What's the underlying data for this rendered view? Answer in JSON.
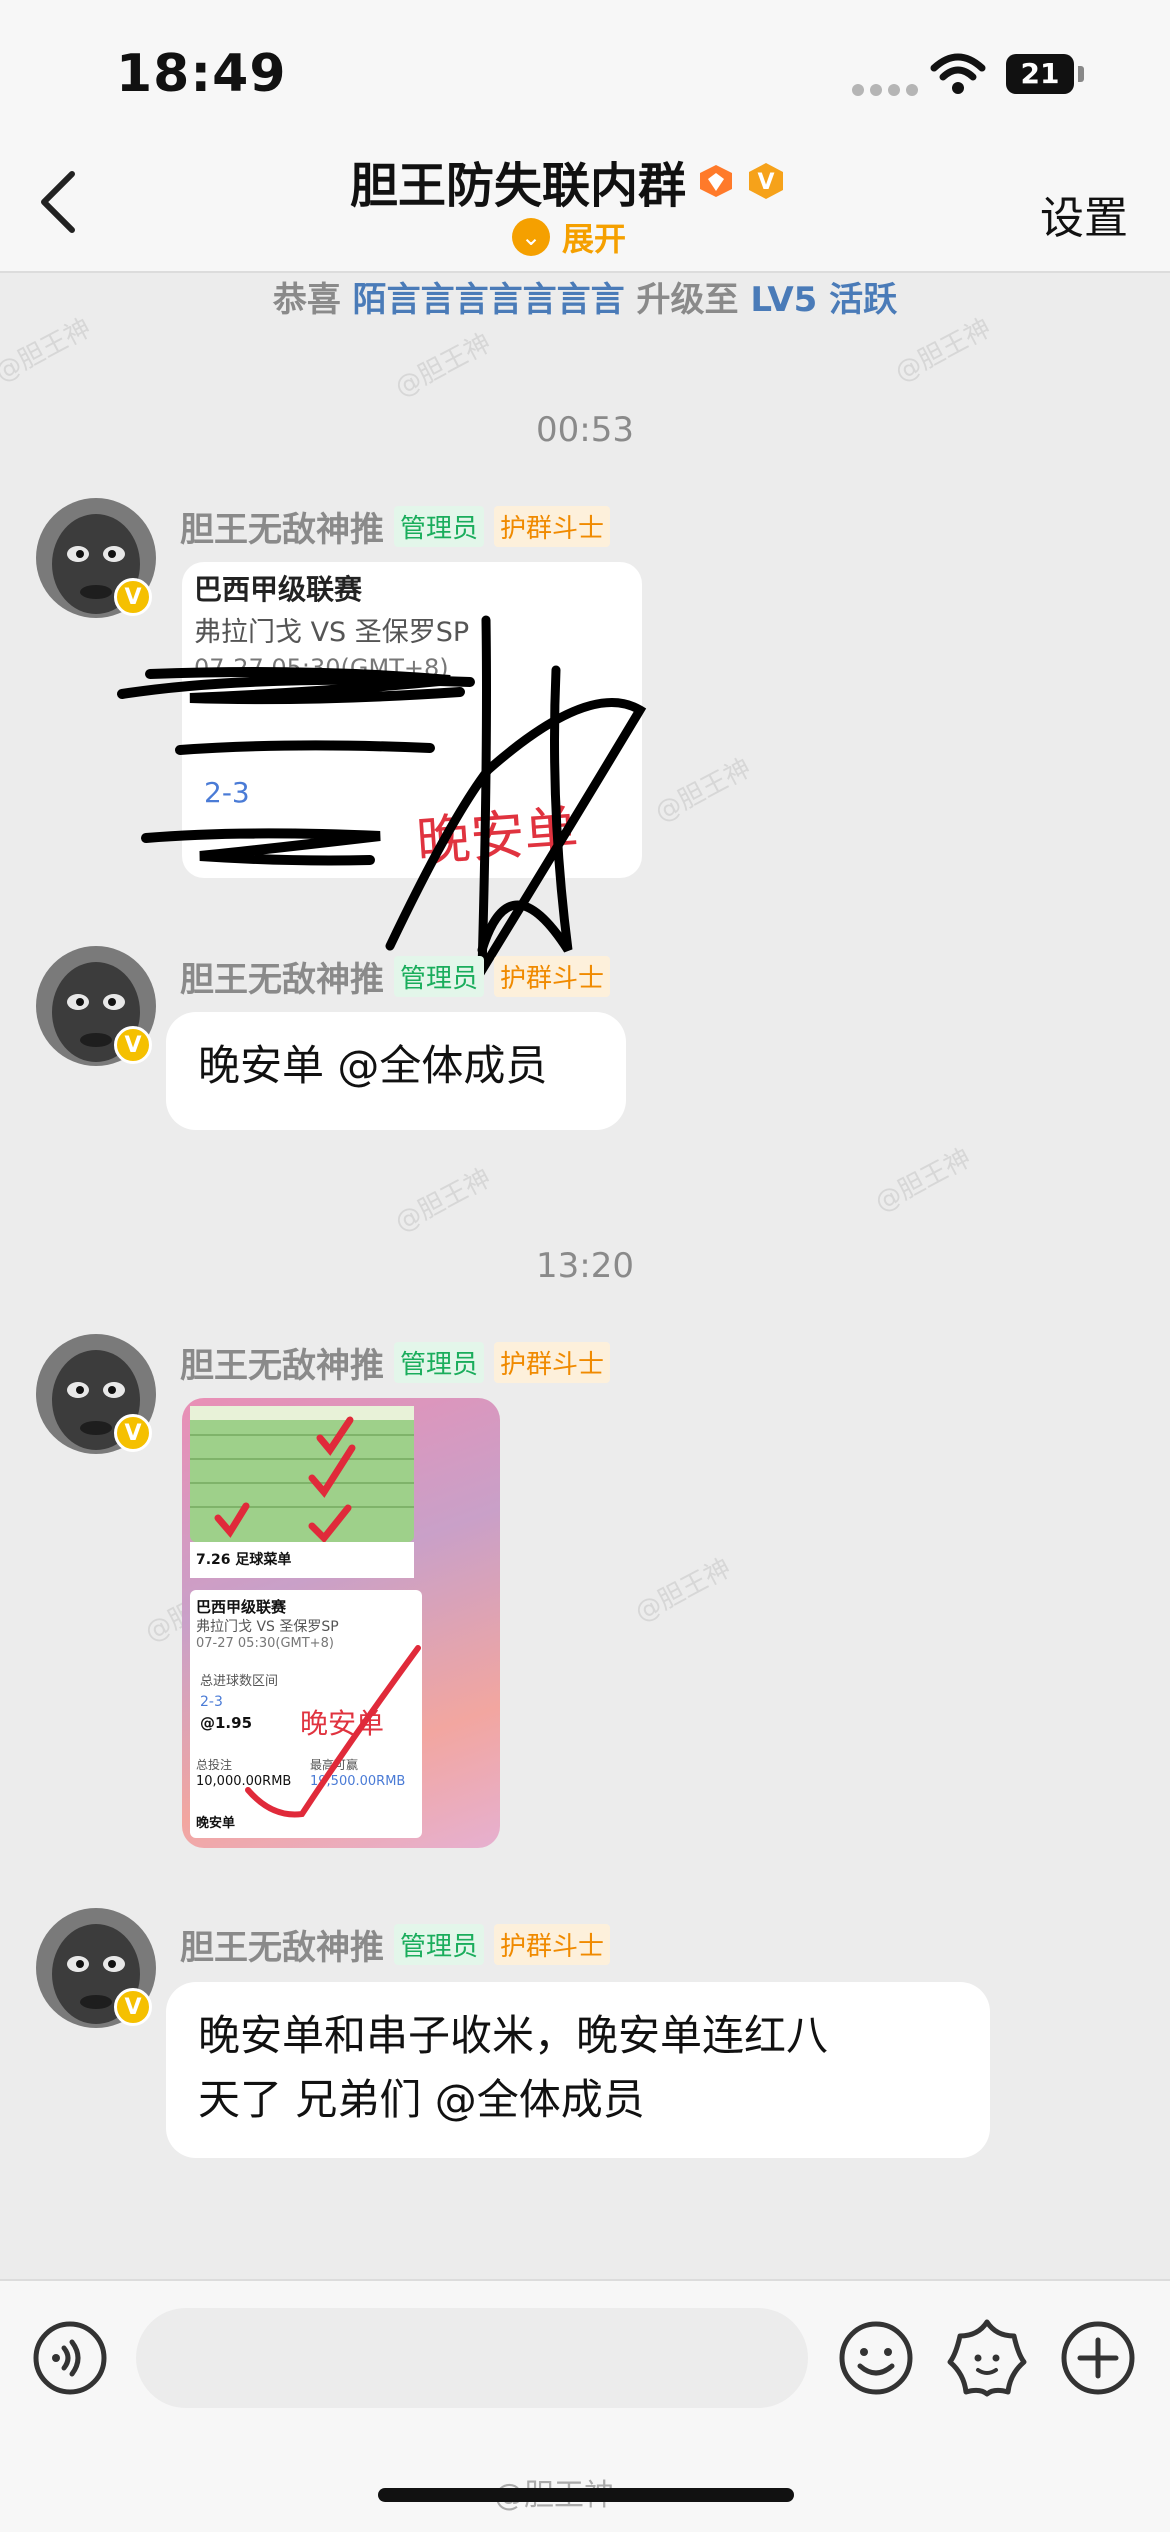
{
  "status_bar": {
    "time": "18:49",
    "battery": "21"
  },
  "header": {
    "title": "胆王防失联内群",
    "expand_label": "展开",
    "settings_label": "设置"
  },
  "notice": {
    "prefix": "恭喜",
    "user": "陌言言言言言言言",
    "middle": "升级至",
    "level": "LV5",
    "suffix": "活跃"
  },
  "watermark": "@胆王神",
  "messages": [
    {
      "timestamp": "00:53",
      "sender": "胆王无敌神推",
      "tags": [
        "管理员",
        "护群斗士"
      ],
      "type": "image",
      "image_text": {
        "league": "巴西甲级联赛",
        "match": "弗拉门戈 VS 圣保罗SP",
        "datetime": "07-27 05:30(GMT+8)",
        "score": "2-3",
        "stamp": "晚安单"
      }
    },
    {
      "sender": "胆王无敌神推",
      "tags": [
        "管理员",
        "护群斗士"
      ],
      "type": "text",
      "text": "晚安单 @全体成员"
    },
    {
      "timestamp": "13:20",
      "sender": "胆王无敌神推",
      "tags": [
        "管理员",
        "护群斗士"
      ],
      "type": "image",
      "image_text": {
        "menu_title": "7.26 足球菜单",
        "league": "巴西甲级联赛",
        "match": "弗拉门戈 VS 圣保罗SP",
        "datetime": "07-27 05:30(GMT+8)",
        "range_label": "总进球数区间",
        "score": "2-3",
        "odds": "@1.95",
        "stamp": "晚安单",
        "total_bet_label": "总投注",
        "total_bet": "10,000.00RMB",
        "payout_label": "最高可赢",
        "payout": "19,500.00RMB",
        "footer": "晚安单"
      }
    },
    {
      "sender": "胆王无敌神推",
      "tags": [
        "管理员",
        "护群斗士"
      ],
      "type": "text",
      "text_line1": "晚安单和串子收米，晚安单连红八",
      "text_line2": "天了 兄弟们 @全体成员"
    }
  ],
  "icons": [
    "back-icon",
    "voice-icon",
    "emoji-icon",
    "sticker-icon",
    "plus-icon",
    "wifi-icon",
    "v-badge-icon",
    "diamond-icon",
    "expand-icon"
  ],
  "colors": {
    "accent_orange": "#f5a000",
    "admin_green": "#1aad5c",
    "link_blue": "#4a7bb8",
    "check_red": "#e02a3a"
  }
}
